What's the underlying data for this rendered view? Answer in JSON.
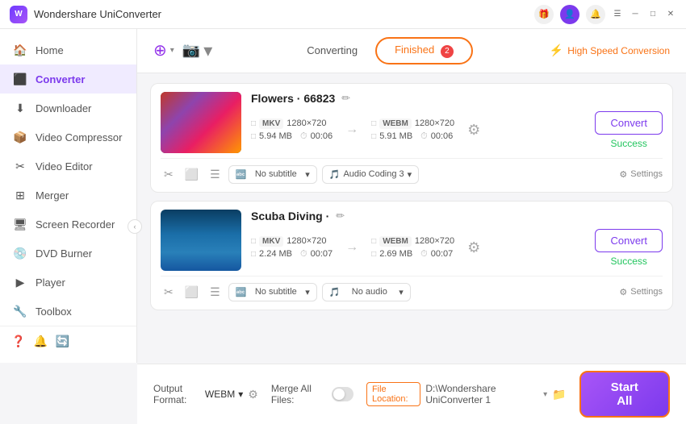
{
  "app": {
    "title": "Wondershare UniConverter",
    "icon_label": "W"
  },
  "titlebar": {
    "icons": [
      "gift-icon",
      "user-icon",
      "bell-icon",
      "menu-icon",
      "minimize-icon",
      "maximize-icon",
      "close-icon"
    ]
  },
  "sidebar": {
    "items": [
      {
        "id": "home",
        "label": "Home",
        "icon": "🏠"
      },
      {
        "id": "converter",
        "label": "Converter",
        "icon": "⬛",
        "active": true
      },
      {
        "id": "downloader",
        "label": "Downloader",
        "icon": "⬇"
      },
      {
        "id": "video-compressor",
        "label": "Video Compressor",
        "icon": "📦"
      },
      {
        "id": "video-editor",
        "label": "Video Editor",
        "icon": "✂"
      },
      {
        "id": "merger",
        "label": "Merger",
        "icon": "⊞"
      },
      {
        "id": "screen-recorder",
        "label": "Screen Recorder",
        "icon": "🖥"
      },
      {
        "id": "dvd-burner",
        "label": "DVD Burner",
        "icon": "💿"
      },
      {
        "id": "player",
        "label": "Player",
        "icon": "▶"
      },
      {
        "id": "toolbox",
        "label": "Toolbox",
        "icon": "🔧"
      }
    ],
    "bottom_icons": [
      "help-icon",
      "notification-icon",
      "update-icon"
    ]
  },
  "topbar": {
    "add_media_label": "+",
    "add_media_sub": "▾",
    "camera_icon": "📷",
    "tab_converting": "Converting",
    "tab_finished": "Finished",
    "finished_badge": "2",
    "speed_label": "High Speed Conversion",
    "speed_icon": "⚡"
  },
  "files": [
    {
      "id": "flowers",
      "title": "Flowers · 66823",
      "thumbnail_type": "flowers",
      "src_format": "MKV",
      "src_resolution": "1280×720",
      "src_size": "5.94 MB",
      "src_duration": "00:06",
      "dst_format": "WEBM",
      "dst_resolution": "1280×720",
      "dst_size": "5.91 MB",
      "dst_duration": "00:06",
      "subtitle": "No subtitle",
      "audio": "Audio Coding 3",
      "convert_label": "Convert",
      "status": "Success"
    },
    {
      "id": "scuba",
      "title": "Scuba Diving ·",
      "thumbnail_type": "diving",
      "src_format": "MKV",
      "src_resolution": "1280×720",
      "src_size": "2.24 MB",
      "src_duration": "00:07",
      "dst_format": "WEBM",
      "dst_resolution": "1280×720",
      "dst_size": "2.69 MB",
      "dst_duration": "00:07",
      "subtitle": "No subtitle",
      "audio": "No audio",
      "convert_label": "Convert",
      "status": "Success"
    }
  ],
  "bottombar": {
    "output_format_label": "Output Format:",
    "output_format_value": "WEBM",
    "merge_label": "Merge All Files:",
    "file_location_label": "File Location:",
    "file_path": "D:\\Wondershare UniConverter 1",
    "start_all_label": "Start All"
  }
}
